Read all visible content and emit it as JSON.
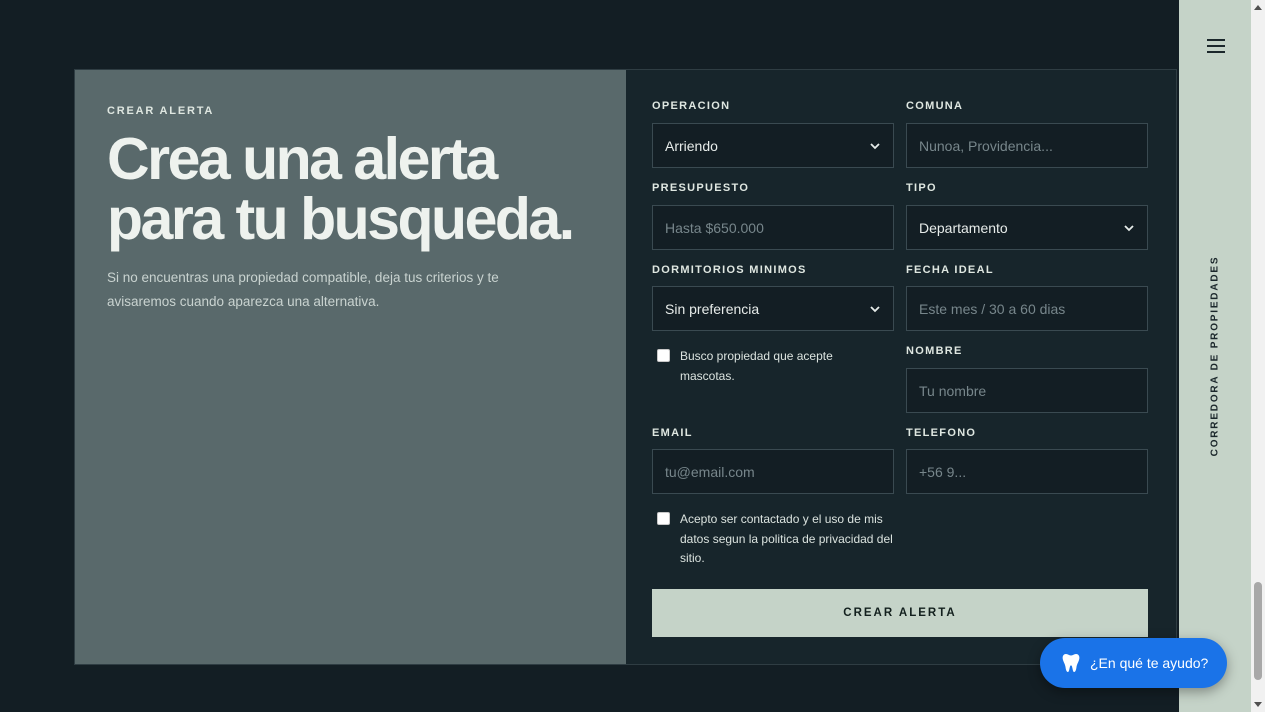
{
  "hero": {
    "eyebrow": "CREAR ALERTA",
    "headline_line1": "Crea una alerta",
    "headline_line2": "para tu busqueda.",
    "intro": "Si no encuentras una propiedad compatible, deja tus criterios y te avisaremos cuando aparezca una alternativa."
  },
  "form": {
    "operacion": {
      "label": "OPERACION",
      "value": "Arriendo"
    },
    "comuna": {
      "label": "COMUNA",
      "placeholder": "Nunoa, Providencia..."
    },
    "presupuesto": {
      "label": "PRESUPUESTO",
      "placeholder": "Hasta $650.000"
    },
    "tipo": {
      "label": "TIPO",
      "value": "Departamento"
    },
    "dormitorios": {
      "label": "DORMITORIOS MINIMOS",
      "value": "Sin preferencia"
    },
    "fecha": {
      "label": "FECHA IDEAL",
      "placeholder": "Este mes / 30 a 60 dias"
    },
    "mascotas": {
      "text": "Busco propiedad que acepte mascotas.",
      "checked": false
    },
    "nombre": {
      "label": "NOMBRE",
      "placeholder": "Tu nombre"
    },
    "email": {
      "label": "EMAIL",
      "placeholder": "tu@email.com"
    },
    "telefono": {
      "label": "TELEFONO",
      "placeholder": "+56 9..."
    },
    "consent": {
      "text": "Acepto ser contactado y el uso de mis datos segun la politica de privacidad del sitio.",
      "checked": false
    },
    "submit_label": "CREAR ALERTA"
  },
  "sidebar": {
    "menu_icon": "hamburger-icon",
    "vertical_text": "CORREDORA DE PROPIEDADES"
  },
  "help_widget": {
    "icon": "tooth-icon",
    "label": "¿En qué te ayudo?"
  },
  "colors": {
    "page_bg": "#131e24",
    "left_panel": "#59696b",
    "form_panel": "#17252b",
    "accent": "#c5d3c8",
    "help_button": "#1a73e8"
  }
}
